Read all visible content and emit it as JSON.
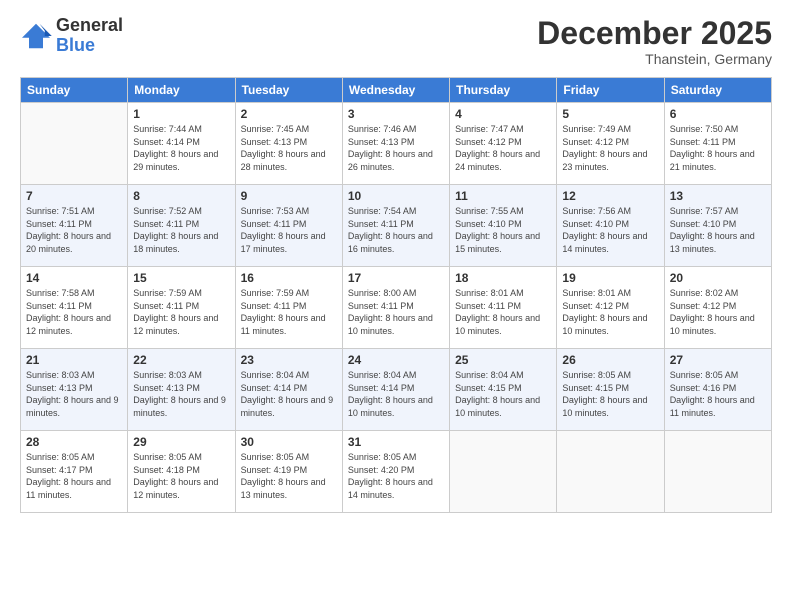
{
  "logo": {
    "general": "General",
    "blue": "Blue"
  },
  "header": {
    "month": "December 2025",
    "location": "Thanstein, Germany"
  },
  "days_of_week": [
    "Sunday",
    "Monday",
    "Tuesday",
    "Wednesday",
    "Thursday",
    "Friday",
    "Saturday"
  ],
  "weeks": [
    [
      {
        "day": "",
        "sunrise": "",
        "sunset": "",
        "daylight": ""
      },
      {
        "day": "1",
        "sunrise": "Sunrise: 7:44 AM",
        "sunset": "Sunset: 4:14 PM",
        "daylight": "Daylight: 8 hours and 29 minutes."
      },
      {
        "day": "2",
        "sunrise": "Sunrise: 7:45 AM",
        "sunset": "Sunset: 4:13 PM",
        "daylight": "Daylight: 8 hours and 28 minutes."
      },
      {
        "day": "3",
        "sunrise": "Sunrise: 7:46 AM",
        "sunset": "Sunset: 4:13 PM",
        "daylight": "Daylight: 8 hours and 26 minutes."
      },
      {
        "day": "4",
        "sunrise": "Sunrise: 7:47 AM",
        "sunset": "Sunset: 4:12 PM",
        "daylight": "Daylight: 8 hours and 24 minutes."
      },
      {
        "day": "5",
        "sunrise": "Sunrise: 7:49 AM",
        "sunset": "Sunset: 4:12 PM",
        "daylight": "Daylight: 8 hours and 23 minutes."
      },
      {
        "day": "6",
        "sunrise": "Sunrise: 7:50 AM",
        "sunset": "Sunset: 4:11 PM",
        "daylight": "Daylight: 8 hours and 21 minutes."
      }
    ],
    [
      {
        "day": "7",
        "sunrise": "Sunrise: 7:51 AM",
        "sunset": "Sunset: 4:11 PM",
        "daylight": "Daylight: 8 hours and 20 minutes."
      },
      {
        "day": "8",
        "sunrise": "Sunrise: 7:52 AM",
        "sunset": "Sunset: 4:11 PM",
        "daylight": "Daylight: 8 hours and 18 minutes."
      },
      {
        "day": "9",
        "sunrise": "Sunrise: 7:53 AM",
        "sunset": "Sunset: 4:11 PM",
        "daylight": "Daylight: 8 hours and 17 minutes."
      },
      {
        "day": "10",
        "sunrise": "Sunrise: 7:54 AM",
        "sunset": "Sunset: 4:11 PM",
        "daylight": "Daylight: 8 hours and 16 minutes."
      },
      {
        "day": "11",
        "sunrise": "Sunrise: 7:55 AM",
        "sunset": "Sunset: 4:10 PM",
        "daylight": "Daylight: 8 hours and 15 minutes."
      },
      {
        "day": "12",
        "sunrise": "Sunrise: 7:56 AM",
        "sunset": "Sunset: 4:10 PM",
        "daylight": "Daylight: 8 hours and 14 minutes."
      },
      {
        "day": "13",
        "sunrise": "Sunrise: 7:57 AM",
        "sunset": "Sunset: 4:10 PM",
        "daylight": "Daylight: 8 hours and 13 minutes."
      }
    ],
    [
      {
        "day": "14",
        "sunrise": "Sunrise: 7:58 AM",
        "sunset": "Sunset: 4:11 PM",
        "daylight": "Daylight: 8 hours and 12 minutes."
      },
      {
        "day": "15",
        "sunrise": "Sunrise: 7:59 AM",
        "sunset": "Sunset: 4:11 PM",
        "daylight": "Daylight: 8 hours and 12 minutes."
      },
      {
        "day": "16",
        "sunrise": "Sunrise: 7:59 AM",
        "sunset": "Sunset: 4:11 PM",
        "daylight": "Daylight: 8 hours and 11 minutes."
      },
      {
        "day": "17",
        "sunrise": "Sunrise: 8:00 AM",
        "sunset": "Sunset: 4:11 PM",
        "daylight": "Daylight: 8 hours and 10 minutes."
      },
      {
        "day": "18",
        "sunrise": "Sunrise: 8:01 AM",
        "sunset": "Sunset: 4:11 PM",
        "daylight": "Daylight: 8 hours and 10 minutes."
      },
      {
        "day": "19",
        "sunrise": "Sunrise: 8:01 AM",
        "sunset": "Sunset: 4:12 PM",
        "daylight": "Daylight: 8 hours and 10 minutes."
      },
      {
        "day": "20",
        "sunrise": "Sunrise: 8:02 AM",
        "sunset": "Sunset: 4:12 PM",
        "daylight": "Daylight: 8 hours and 10 minutes."
      }
    ],
    [
      {
        "day": "21",
        "sunrise": "Sunrise: 8:03 AM",
        "sunset": "Sunset: 4:13 PM",
        "daylight": "Daylight: 8 hours and 9 minutes."
      },
      {
        "day": "22",
        "sunrise": "Sunrise: 8:03 AM",
        "sunset": "Sunset: 4:13 PM",
        "daylight": "Daylight: 8 hours and 9 minutes."
      },
      {
        "day": "23",
        "sunrise": "Sunrise: 8:04 AM",
        "sunset": "Sunset: 4:14 PM",
        "daylight": "Daylight: 8 hours and 9 minutes."
      },
      {
        "day": "24",
        "sunrise": "Sunrise: 8:04 AM",
        "sunset": "Sunset: 4:14 PM",
        "daylight": "Daylight: 8 hours and 10 minutes."
      },
      {
        "day": "25",
        "sunrise": "Sunrise: 8:04 AM",
        "sunset": "Sunset: 4:15 PM",
        "daylight": "Daylight: 8 hours and 10 minutes."
      },
      {
        "day": "26",
        "sunrise": "Sunrise: 8:05 AM",
        "sunset": "Sunset: 4:15 PM",
        "daylight": "Daylight: 8 hours and 10 minutes."
      },
      {
        "day": "27",
        "sunrise": "Sunrise: 8:05 AM",
        "sunset": "Sunset: 4:16 PM",
        "daylight": "Daylight: 8 hours and 11 minutes."
      }
    ],
    [
      {
        "day": "28",
        "sunrise": "Sunrise: 8:05 AM",
        "sunset": "Sunset: 4:17 PM",
        "daylight": "Daylight: 8 hours and 11 minutes."
      },
      {
        "day": "29",
        "sunrise": "Sunrise: 8:05 AM",
        "sunset": "Sunset: 4:18 PM",
        "daylight": "Daylight: 8 hours and 12 minutes."
      },
      {
        "day": "30",
        "sunrise": "Sunrise: 8:05 AM",
        "sunset": "Sunset: 4:19 PM",
        "daylight": "Daylight: 8 hours and 13 minutes."
      },
      {
        "day": "31",
        "sunrise": "Sunrise: 8:05 AM",
        "sunset": "Sunset: 4:20 PM",
        "daylight": "Daylight: 8 hours and 14 minutes."
      },
      {
        "day": "",
        "sunrise": "",
        "sunset": "",
        "daylight": ""
      },
      {
        "day": "",
        "sunrise": "",
        "sunset": "",
        "daylight": ""
      },
      {
        "day": "",
        "sunrise": "",
        "sunset": "",
        "daylight": ""
      }
    ]
  ]
}
